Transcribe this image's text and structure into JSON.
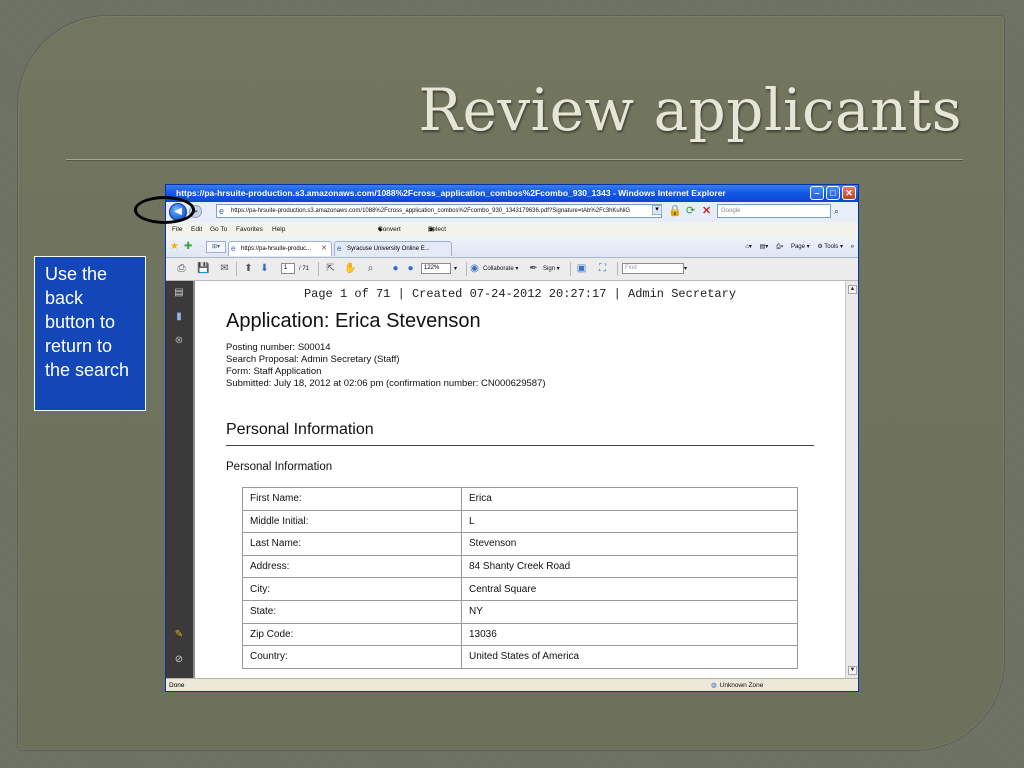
{
  "slide": {
    "title": "Review applicants",
    "callout": "Use the back button to return to the search"
  },
  "browser": {
    "window_title": "https://pa-hrsuite-production.s3.amazonaws.com/1088%2Fcross_application_combos%2Fcombo_930_1343 - Windows Internet Explorer",
    "address": "https://pa-hrsuite-production.s3.amazonaws.com/1088%2Fcross_application_combos%2Fcombo_930_1343179636.pdf?Signature=tAb%2Fc3hKuNiG",
    "search_placeholder": "Google",
    "menu": {
      "file": "File",
      "edit": "Edit",
      "goto": "Go To",
      "favorites": "Favorites",
      "help": "Help",
      "convert": "Convert",
      "select": "Select"
    },
    "tabs": [
      {
        "label": "https://pa-hrsuite-produc..."
      },
      {
        "label": "Syracuse University Online E..."
      }
    ],
    "tab_tools": {
      "page": "Page",
      "tools": "Tools",
      "more": "»"
    },
    "pdf_toolbar": {
      "page_input": "1",
      "page_total": "/ 71",
      "zoom": "122%",
      "collaborate": "Collaborate",
      "sign": "Sign",
      "find_placeholder": "Find"
    },
    "status": {
      "left": "Done",
      "zone": "Unknown Zone"
    }
  },
  "document": {
    "header": "Page 1 of 71 | Created 07-24-2012 20:27:17 | Admin Secretary",
    "title": "Application: Erica Stevenson",
    "meta": [
      "Posting number: S00014",
      "Search Proposal: Admin Secretary (Staff)",
      "Form: Staff Application",
      "Submitted: July 18, 2012 at 02:06 pm (confirmation number: CN000629587)"
    ],
    "section_title": "Personal Information",
    "subsection_title": "Personal Information",
    "fields": [
      {
        "label": "First Name:",
        "value": "Erica"
      },
      {
        "label": "Middle Initial:",
        "value": "L"
      },
      {
        "label": "Last Name:",
        "value": "Stevenson"
      },
      {
        "label": "Address:",
        "value": "84 Shanty Creek Road"
      },
      {
        "label": "City:",
        "value": "Central Square"
      },
      {
        "label": "State:",
        "value": "NY"
      },
      {
        "label": "Zip Code:",
        "value": "13036"
      },
      {
        "label": "Country:",
        "value": "United States of America"
      }
    ]
  },
  "colors": {
    "slide_bg": "#6e735f",
    "callout_bg": "#1347b8",
    "title_text": "#e7e6d6",
    "ie_titlebar": "#1459e6"
  }
}
